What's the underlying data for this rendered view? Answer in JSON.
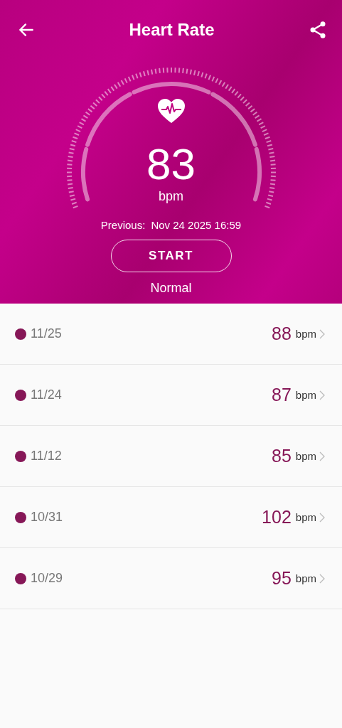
{
  "header": {
    "title": "Heart Rate"
  },
  "measurement": {
    "value": "83",
    "unit": "bpm",
    "previous_label": "Previous:",
    "previous_time": "Nov 24 2025 16:59",
    "button": "START",
    "status": "Normal"
  },
  "history": [
    {
      "date": "11/25",
      "value": "88",
      "unit": "bpm"
    },
    {
      "date": "11/24",
      "value": "87",
      "unit": "bpm"
    },
    {
      "date": "11/12",
      "value": "85",
      "unit": "bpm"
    },
    {
      "date": "10/31",
      "value": "102",
      "unit": "bpm"
    },
    {
      "date": "10/29",
      "value": "95",
      "unit": "bpm"
    }
  ]
}
